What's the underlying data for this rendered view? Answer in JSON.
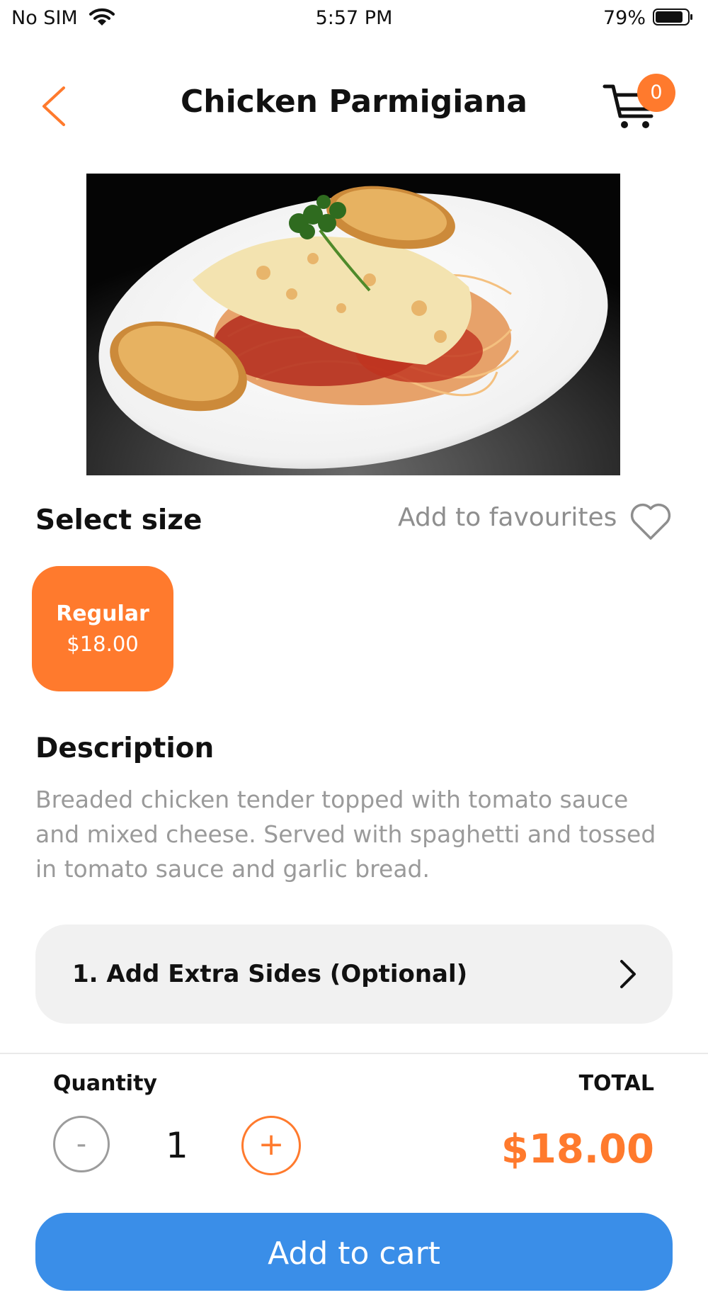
{
  "status_bar": {
    "carrier": "No SIM",
    "time": "5:57 PM",
    "battery": "79%"
  },
  "header": {
    "title": "Chicken Parmigiana",
    "cart_count": "0"
  },
  "icons": {
    "back": "chevron-left-icon",
    "cart": "cart-icon",
    "favourite": "heart-icon",
    "option_chevron": "chevron-right-icon",
    "wifi": "wifi-icon",
    "battery": "battery-icon"
  },
  "size": {
    "label": "Select size",
    "favourites_label": "Add to favourites",
    "options": [
      {
        "name": "Regular",
        "price": "$18.00"
      }
    ]
  },
  "description": {
    "title": "Description",
    "text": "Breaded chicken tender topped with tomato sauce and mixed cheese. Served with spaghetti and tossed in tomato sauce and garlic bread."
  },
  "options": [
    {
      "label": "1. Add Extra Sides  (Optional)"
    }
  ],
  "order": {
    "quantity_label": "Quantity",
    "quantity": "1",
    "minus": "-",
    "plus": "+",
    "total_label": "TOTAL",
    "total": "$18.00"
  },
  "cta": {
    "label": "Add to cart"
  },
  "colors": {
    "accent": "#ff7a2d",
    "cta": "#3a8ee8",
    "muted_text": "#9a9a9a",
    "option_bg": "#f1f1f1"
  }
}
